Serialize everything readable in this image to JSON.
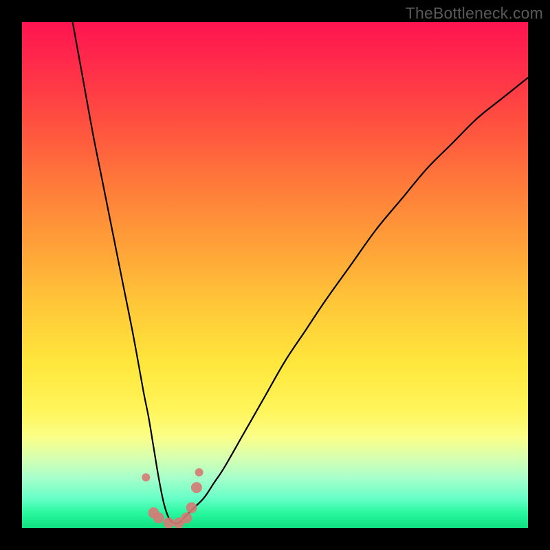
{
  "watermark": {
    "text": "TheBottleneck.com"
  },
  "chart_data": {
    "type": "line",
    "title": "",
    "xlabel": "",
    "ylabel": "",
    "xlim": [
      0,
      100
    ],
    "ylim": [
      0,
      100
    ],
    "series": [
      {
        "name": "curve",
        "x": [
          10,
          12,
          14,
          16,
          18,
          20,
          22,
          24,
          25,
          26,
          27,
          28,
          29,
          30,
          31,
          32,
          34,
          36,
          38,
          40,
          44,
          48,
          52,
          56,
          60,
          65,
          70,
          75,
          80,
          85,
          90,
          95,
          100
        ],
        "values": [
          100,
          89,
          78,
          68,
          58,
          48,
          38,
          27,
          22,
          16,
          10,
          5,
          2,
          1,
          1,
          2,
          4,
          6,
          9,
          12,
          19,
          26,
          33,
          39,
          45,
          52,
          59,
          65,
          71,
          76,
          81,
          85,
          89
        ]
      }
    ],
    "markers": [
      {
        "x": 24.5,
        "y": 10
      },
      {
        "x": 26.0,
        "y": 3
      },
      {
        "x": 27.0,
        "y": 2
      },
      {
        "x": 29.0,
        "y": 1
      },
      {
        "x": 31.0,
        "y": 1
      },
      {
        "x": 32.5,
        "y": 2
      },
      {
        "x": 33.5,
        "y": 4
      },
      {
        "x": 34.5,
        "y": 8
      },
      {
        "x": 35.0,
        "y": 11
      }
    ]
  }
}
